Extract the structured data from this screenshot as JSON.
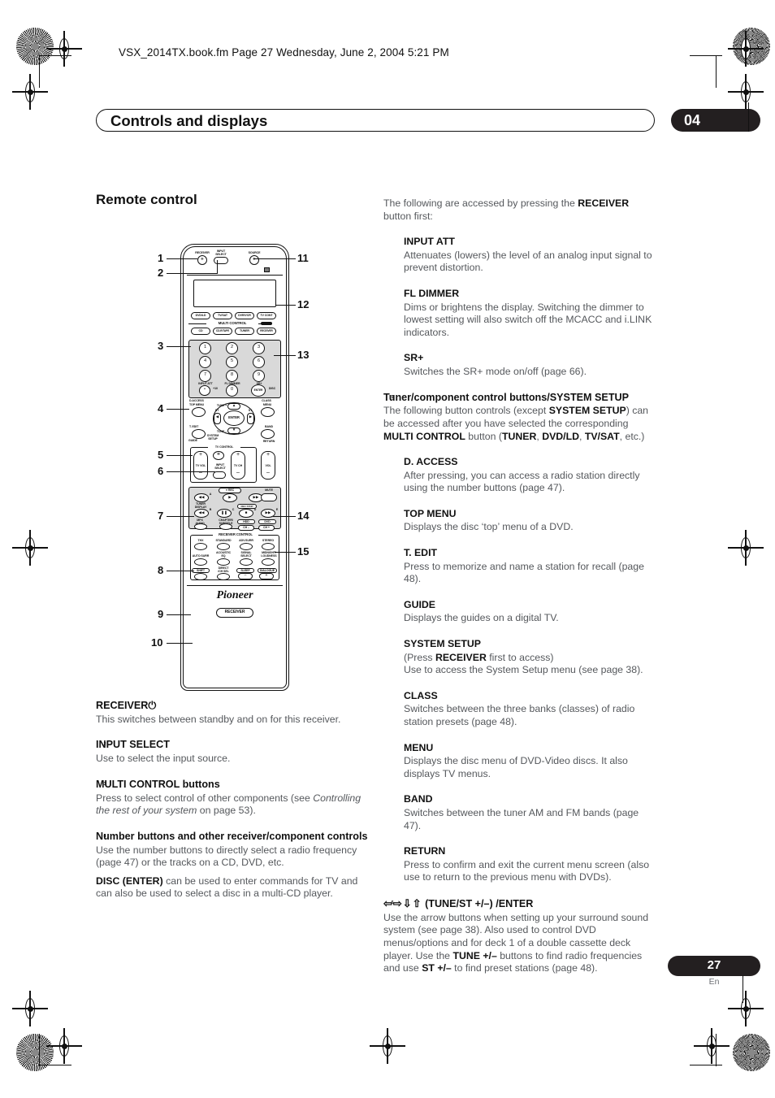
{
  "print": {
    "file_header": "VSX_2014TX.book.fm  Page 27  Wednesday, June 2, 2004  5:21 PM"
  },
  "header": {
    "chapter_title": "Controls and displays",
    "chapter_number": "04"
  },
  "footer": {
    "page_number": "27",
    "language": "En"
  },
  "left_column": {
    "section_title": "Remote control",
    "items": [
      {
        "num": "1",
        "title": "RECEIVER⏻",
        "body": [
          "This switches between standby and on for this receiver."
        ]
      },
      {
        "num": "2",
        "title": "INPUT SELECT",
        "body": [
          "Use to select the input source."
        ]
      },
      {
        "num": "3",
        "title": "MULTI CONTROL buttons",
        "body": [
          "Press to select control of other components (see ",
          "Controlling the rest of your system",
          " on page 53)."
        ]
      },
      {
        "num": "4",
        "title": "Number buttons and other receiver/component controls",
        "body": [
          "Use the number buttons to directly select a radio frequency (page 47) or the tracks on a CD, DVD, etc.",
          "DISC (ENTER) can be used to enter commands for TV and can also be used to select a disc in a multi-CD player."
        ]
      }
    ]
  },
  "right_column": {
    "intro": "The following are accessed by pressing the RECEIVER button first:",
    "intro_plain_1": "The following are accessed by pressing the ",
    "intro_bold": "RECEIVER",
    "intro_plain_2": "button first:",
    "sub_items_top": [
      {
        "title": "INPUT ATT",
        "body": "Attenuates (lowers) the level of an analog input signal to prevent distortion."
      },
      {
        "title": "FL DIMMER",
        "body": "Dims or brightens the display. Switching the dimmer to lowest setting will also switch off the MCACC and i.LINK indicators."
      },
      {
        "title": "SR+",
        "body": "Switches the SR+ mode on/off (page 66)."
      }
    ],
    "item5": {
      "num": "5",
      "title": "Tuner/component control buttons/SYSTEM SETUP",
      "body_1": "The following button controls (except ",
      "body_b1": "SYSTEM SETUP",
      "body_2": ") can be accessed after you have selected the corresponding ",
      "body_b2": "MULTI CONTROL",
      "body_3": " button (",
      "body_b3": "TUNER",
      "body_4": ", ",
      "body_b4": "DVD/LD",
      "body_5": ", ",
      "body_b5": "TV/SAT",
      "body_6": ", etc.)"
    },
    "sub_items_bottom": [
      {
        "title": "D. ACCESS",
        "body": "After pressing, you can access a radio station directly using the number buttons (page 47)."
      },
      {
        "title": "TOP MENU",
        "body": "Displays the disc ‘top’ menu of a DVD."
      },
      {
        "title": "T. EDIT",
        "body": "Press to memorize and name a station for recall (page 48)."
      },
      {
        "title": "GUIDE",
        "body": "Displays the guides on a digital TV."
      },
      {
        "title": "SYSTEM SETUP",
        "body_line1_a": "(Press ",
        "body_line1_b": "RECEIVER",
        "body_line1_c": " first to access)",
        "body_line2": "Use to access the System Setup menu (see page 38)."
      },
      {
        "title": "CLASS",
        "body": "Switches between the three banks (classes) of radio station presets (page 48)."
      },
      {
        "title": "MENU",
        "body": "Displays the disc menu of DVD-Video discs. It also displays TV menus."
      },
      {
        "title": "BAND",
        "body": "Switches between the tuner AM and FM bands (page 47)."
      },
      {
        "title": "RETURN",
        "body": "Press to confirm and exit the current menu screen (also use to return to the previous menu with DVDs)."
      }
    ],
    "item6": {
      "num": "6",
      "arrows": "⇦⇨⇩⇧",
      "title": "(TUNE/ST +/–) /ENTER",
      "body_1": "Use the arrow buttons when setting up your surround sound system (see page 38). Also used to control DVD menus/options and for deck 1 of a double cassette deck player. Use the ",
      "body_b1": "TUNE +/–",
      "body_2": " buttons to find radio frequencies and use ",
      "body_b2": "ST +/–",
      "body_3": " to find preset stations (page 48)."
    }
  },
  "diagram": {
    "name": "remote-control",
    "callouts": [
      "1",
      "2",
      "3",
      "4",
      "5",
      "6",
      "7",
      "8",
      "9",
      "10",
      "11",
      "12",
      "13",
      "14",
      "15"
    ],
    "top_buttons": {
      "receiver": "RECEIVER",
      "input_select": "INPUT\nSELECT",
      "source": "SOURCE"
    },
    "multi_control": {
      "group_label": "MULTI CONTROL",
      "row1": [
        "DVD/LD",
        "TV/SAT",
        "DVR/VCR",
        "TV CONT"
      ],
      "row2": [
        "CD",
        "CD-R/TAPE",
        "TUNER",
        "RECEIVER"
      ]
    },
    "numpad": {
      "keys": [
        "1",
        "2",
        "3",
        "4",
        "5",
        "6",
        "7",
        "8",
        "9",
        "•",
        "0",
        "ENTER"
      ],
      "plus10": "+10",
      "above": [
        "INPUT ATT",
        "FL DIMMER",
        "SR+"
      ],
      "disc": "DISC",
      "below": [
        "D.ACCESS",
        "CLASS"
      ]
    },
    "menu_area": {
      "top_menu": "TOP MENU",
      "menu": "MENU",
      "t_edit": "T. EDIT",
      "band": "BAND",
      "guide": "GUIDE",
      "return": "RETURN",
      "system_setup": "SYSTEM\nSETUP",
      "enter": "ENTER",
      "tune": "TUNE",
      "st": "ST"
    },
    "tv_control": {
      "group_label": "TV CONTROL",
      "tv_vol": "TV VOL",
      "input_select": "INPUT\nSELECT",
      "tv_ch": "TV CH",
      "vol": "VOL"
    },
    "transport": {
      "rec": "REC",
      "mute": "MUTE",
      "tuner_display": "TUNER\nDISPLAY",
      "rec_stop": "REC STOP",
      "mpx_audio": "MPX\nAUDIO",
      "chapter_subtitle": "CHAPTER/\nSUBTITLE",
      "hdd": "HDD",
      "dvd": "DVD",
      "ch_minus": "CH –",
      "ch_plus": "CH +",
      "marks": [
        "A",
        "B",
        "C",
        "D",
        "E"
      ]
    },
    "receiver_control": {
      "group_label": "RECEIVER CONTROL",
      "row1": [
        "THX",
        "STANDARD",
        "ADV.SURR",
        "STEREO"
      ],
      "row2": [
        "AUTO SURR",
        "ACOUSTIC EQ",
        "SIGNAL SELECT",
        "MIDNIGHT/ LOUDNESS"
      ],
      "row3": [
        "SHIFT",
        "DIRECT /CH SEL",
        "SLEEP",
        "DIALOGUE"
      ]
    },
    "brand": "Pioneer",
    "bottom_label": "RECEIVER"
  }
}
